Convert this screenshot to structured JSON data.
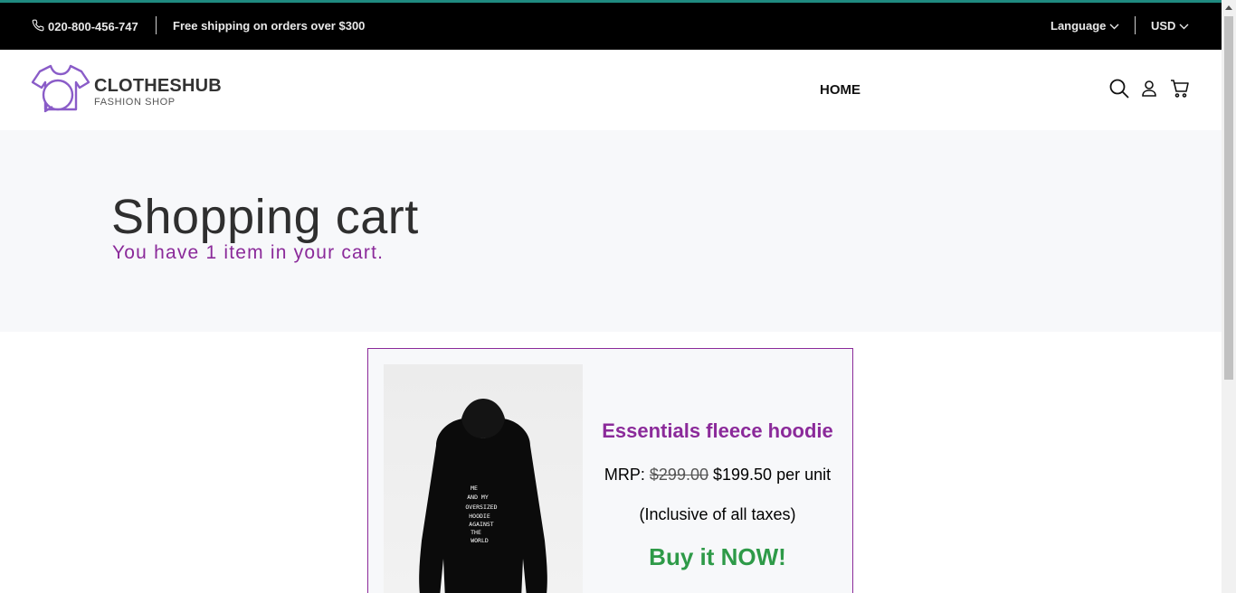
{
  "topbar": {
    "phone": "020-800-456-747",
    "shipping": "Free shipping on orders over $300",
    "language_label": "Language",
    "currency_label": "USD"
  },
  "header": {
    "brand_name": "CLOTHESHUB",
    "brand_tagline": "FASHION SHOP",
    "nav_home": "HOME",
    "icons": [
      "search-icon",
      "user-icon",
      "cart-icon"
    ]
  },
  "hero": {
    "title": "Shopping cart",
    "subtitle": "You have 1 item in your cart."
  },
  "cart_item": {
    "image_print_text": [
      "ME",
      "AND MY",
      "OVERSIZED",
      "HOODIE",
      "AGAINST",
      "THE",
      "WORLD"
    ],
    "name": "Essentials fleece hoodie",
    "mrp_label": "MRP:",
    "old_price": "$299.00",
    "new_price": "$199.50 per unit",
    "taxes_note": "(Inclusive of all taxes)",
    "buy_label": "Buy it NOW!"
  },
  "colors": {
    "accent_purple": "#8b2a9a",
    "buy_green": "#2e9a48",
    "topbar_bg": "#000000",
    "topbar_border": "#1f8a80"
  }
}
